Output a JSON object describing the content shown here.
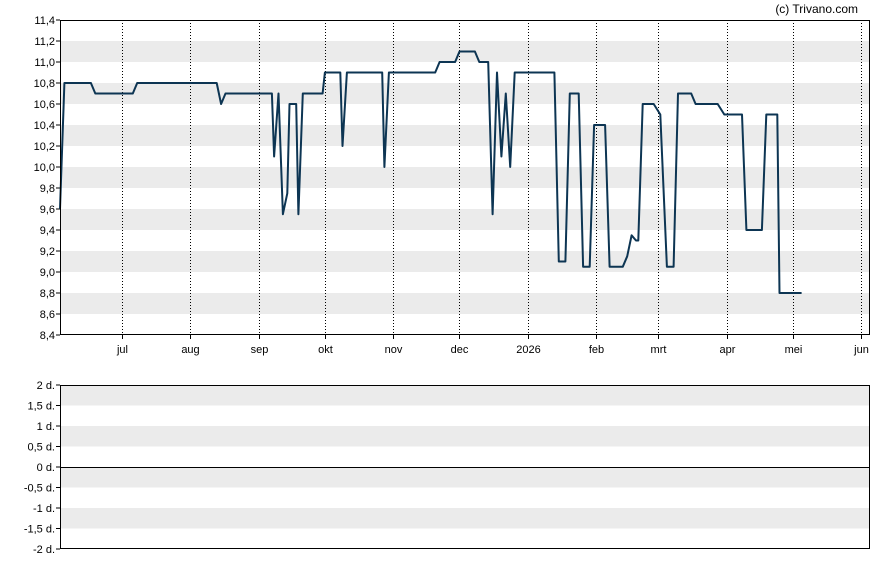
{
  "credit": "(c) Trivano.com",
  "colors": {
    "line": "#0d3553",
    "band": "#ebebeb",
    "grid": "#000000",
    "frame": "#000000"
  },
  "chart_data": [
    {
      "type": "line",
      "title": "",
      "xlabel": "",
      "ylabel": "",
      "grid": true,
      "ylim": [
        8.4,
        11.4
      ],
      "y_tick_labels": [
        "8,4",
        "8,6",
        "8,8",
        "9,0",
        "9,2",
        "9,4",
        "9,6",
        "9,8",
        "10,0",
        "10,2",
        "10,4",
        "10,6",
        "10,8",
        "11,0",
        "11,2",
        "11,4"
      ],
      "y_tick_values": [
        8.4,
        8.6,
        8.8,
        9.0,
        9.2,
        9.4,
        9.6,
        9.8,
        10.0,
        10.2,
        10.4,
        10.6,
        10.8,
        11.0,
        11.2,
        11.4
      ],
      "xlim": [
        "2025-06-03",
        "2026-06-05"
      ],
      "x_ticks": [
        {
          "label": "jul",
          "date": "2025-07-01"
        },
        {
          "label": "aug",
          "date": "2025-08-01"
        },
        {
          "label": "sep",
          "date": "2025-09-01"
        },
        {
          "label": "okt",
          "date": "2025-10-01"
        },
        {
          "label": "nov",
          "date": "2025-11-01"
        },
        {
          "label": "dec",
          "date": "2025-12-01"
        },
        {
          "label": "2026",
          "date": "2026-01-01"
        },
        {
          "label": "feb",
          "date": "2026-02-01"
        },
        {
          "label": "mrt",
          "date": "2026-03-01"
        },
        {
          "label": "apr",
          "date": "2026-04-01"
        },
        {
          "label": "mei",
          "date": "2026-05-01"
        },
        {
          "label": "jun",
          "date": "2026-06-01"
        }
      ],
      "series": [
        {
          "points": [
            [
              "2025-06-03",
              9.6
            ],
            [
              "2025-06-05",
              10.8
            ],
            [
              "2025-06-17",
              10.8
            ],
            [
              "2025-06-19",
              10.7
            ],
            [
              "2025-07-06",
              10.7
            ],
            [
              "2025-07-08",
              10.8
            ],
            [
              "2025-08-13",
              10.8
            ],
            [
              "2025-08-15",
              10.6
            ],
            [
              "2025-08-17",
              10.7
            ],
            [
              "2025-09-07",
              10.7
            ],
            [
              "2025-09-08",
              10.1
            ],
            [
              "2025-09-10",
              10.7
            ],
            [
              "2025-09-12",
              9.55
            ],
            [
              "2025-09-14",
              9.75
            ],
            [
              "2025-09-15",
              10.6
            ],
            [
              "2025-09-18",
              10.6
            ],
            [
              "2025-09-19",
              9.55
            ],
            [
              "2025-09-21",
              10.7
            ],
            [
              "2025-09-30",
              10.7
            ],
            [
              "2025-10-01",
              10.9
            ],
            [
              "2025-10-08",
              10.9
            ],
            [
              "2025-10-09",
              10.2
            ],
            [
              "2025-10-11",
              10.9
            ],
            [
              "2025-10-27",
              10.9
            ],
            [
              "2025-10-28",
              10.0
            ],
            [
              "2025-10-30",
              10.9
            ],
            [
              "2025-11-20",
              10.9
            ],
            [
              "2025-11-22",
              11.0
            ],
            [
              "2025-11-29",
              11.0
            ],
            [
              "2025-12-01",
              11.1
            ],
            [
              "2025-12-08",
              11.1
            ],
            [
              "2025-12-10",
              11.0
            ],
            [
              "2025-12-14",
              11.0
            ],
            [
              "2025-12-16",
              9.55
            ],
            [
              "2025-12-18",
              10.9
            ],
            [
              "2025-12-20",
              10.1
            ],
            [
              "2025-12-22",
              10.7
            ],
            [
              "2025-12-24",
              10.0
            ],
            [
              "2025-12-26",
              10.9
            ],
            [
              "2026-01-13",
              10.9
            ],
            [
              "2026-01-15",
              9.1
            ],
            [
              "2026-01-18",
              9.1
            ],
            [
              "2026-01-20",
              10.7
            ],
            [
              "2026-01-24",
              10.7
            ],
            [
              "2026-01-26",
              9.05
            ],
            [
              "2026-01-29",
              9.05
            ],
            [
              "2026-01-31",
              10.4
            ],
            [
              "2026-02-05",
              10.4
            ],
            [
              "2026-02-07",
              9.05
            ],
            [
              "2026-02-13",
              9.05
            ],
            [
              "2026-02-15",
              9.15
            ],
            [
              "2026-02-17",
              9.35
            ],
            [
              "2026-02-19",
              9.3
            ],
            [
              "2026-02-20",
              9.3
            ],
            [
              "2026-02-22",
              10.6
            ],
            [
              "2026-02-27",
              10.6
            ],
            [
              "2026-03-02",
              10.5
            ],
            [
              "2026-03-05",
              9.05
            ],
            [
              "2026-03-08",
              9.05
            ],
            [
              "2026-03-10",
              10.7
            ],
            [
              "2026-03-16",
              10.7
            ],
            [
              "2026-03-18",
              10.6
            ],
            [
              "2026-03-28",
              10.6
            ],
            [
              "2026-03-31",
              10.5
            ],
            [
              "2026-04-08",
              10.5
            ],
            [
              "2026-04-10",
              9.4
            ],
            [
              "2026-04-17",
              9.4
            ],
            [
              "2026-04-19",
              10.5
            ],
            [
              "2026-04-24",
              10.5
            ],
            [
              "2026-04-25",
              8.8
            ],
            [
              "2026-05-05",
              8.8
            ]
          ]
        }
      ]
    },
    {
      "type": "line",
      "title": "",
      "xlabel": "",
      "ylabel": "",
      "grid": true,
      "ylim": [
        -2,
        2
      ],
      "y_tick_labels": [
        "-2 d.",
        "-1,5 d.",
        "-1 d.",
        "-0,5 d.",
        "0 d.",
        "0,5 d.",
        "1 d.",
        "1,5 d.",
        "2 d."
      ],
      "y_tick_values": [
        -2,
        -1.5,
        -1,
        -0.5,
        0,
        0.5,
        1,
        1.5,
        2
      ],
      "reference_line": 0,
      "series": []
    }
  ]
}
